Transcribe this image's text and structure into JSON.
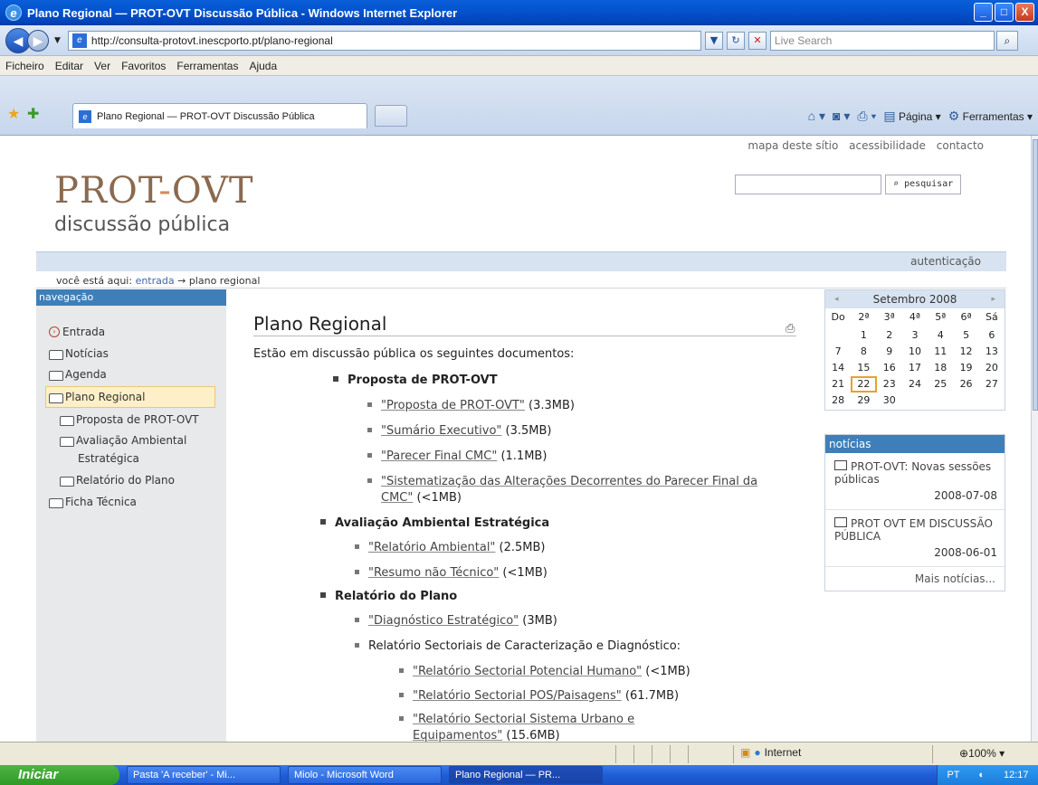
{
  "window": {
    "title": "Plano Regional — PROT-OVT Discussão Pública - Windows Internet Explorer",
    "buttons": {
      "min": "_",
      "max": "□",
      "close": "X"
    }
  },
  "browser": {
    "url": "http://consulta-protovt.inescporto.pt/plano-regional",
    "search_placeholder": "Live Search",
    "menu": [
      "Ficheiro",
      "Editar",
      "Ver",
      "Favoritos",
      "Ferramentas",
      "Ajuda"
    ],
    "tab_title": "Plano Regional — PROT-OVT Discussão Pública",
    "cmd": {
      "page": "Página",
      "tools": "Ferramentas"
    },
    "status": {
      "zone": "Internet",
      "zoom": "100%"
    }
  },
  "site": {
    "top_links": [
      "mapa deste sítio",
      "acessibilidade",
      "contacto"
    ],
    "logo_a": "PROT",
    "logo_dash": "-",
    "logo_b": "OVT",
    "logo_sub": "discussão pública",
    "search_button": "pesquisar",
    "auth": "autenticação",
    "crumb_prefix": "você está aqui:",
    "crumb_home": "entrada",
    "crumb_arrow": "→",
    "crumb_current": "plano regional"
  },
  "nav": {
    "head": "navegação",
    "items": [
      "Entrada",
      "Notícias",
      "Agenda",
      "Plano Regional",
      "Proposta de PROT-OVT",
      "Avaliação Ambiental",
      "Estratégica",
      "Relatório do Plano",
      "Ficha Técnica"
    ]
  },
  "content": {
    "title": "Plano Regional",
    "intro": "Estão em discussão pública os seguintes documentos:",
    "s1": "Proposta de PROT-OVT",
    "d1": "\"Proposta de PROT-OVT\"",
    "d1s": " (3.3MB)",
    "d2": "\"Sumário Executivo\"",
    "d2s": " (3.5MB)",
    "d3": "\"Parecer Final CMC\"",
    "d3s": " (1.1MB)",
    "d4a": "\"Sistematização das Alterações Decorrentes do Parecer Final da",
    "d4b": "CMC\"",
    "d4s": " (<1MB)",
    "s2": "Avaliação Ambiental Estratégica",
    "d5": "\"Relatório Ambiental\"",
    "d5s": " (2.5MB)",
    "d6": "\"Resumo não Técnico\"",
    "d6s": " (<1MB)",
    "s3": "Relatório do Plano",
    "d7": "\"Diagnóstico Estratégico\"",
    "d7s": " (3MB)",
    "d8": "Relatório Sectoriais de Caracterização e Diagnóstico:",
    "d9": "\"Relatório Sectorial Potencial Humano\"",
    "d9s": " (<1MB)",
    "d10": "\"Relatório Sectorial POS/Paisagens\"",
    "d10s": " (61.7MB)",
    "d11a": "\"Relatório Sectorial Sistema Urbano e",
    "d11b": "Equipamentos\"",
    "d11s": " (15.6MB)"
  },
  "calendar": {
    "month": "Setembro 2008",
    "prev": "◂",
    "next": "▸",
    "days": [
      "Do",
      "2ª",
      "3ª",
      "4ª",
      "5ª",
      "6ª",
      "Sá"
    ],
    "cells": [
      "",
      "1",
      "2",
      "3",
      "4",
      "5",
      "6",
      "7",
      "8",
      "9",
      "10",
      "11",
      "12",
      "13",
      "14",
      "15",
      "16",
      "17",
      "18",
      "19",
      "20",
      "21",
      "22",
      "23",
      "24",
      "25",
      "26",
      "27",
      "28",
      "29",
      "30",
      "",
      "",
      "",
      ""
    ],
    "today": "22"
  },
  "news": {
    "head": "notícias",
    "items": [
      {
        "title": "PROT-OVT: Novas sessões públicas",
        "date": "2008-07-08"
      },
      {
        "title": "PROT OVT EM DISCUSSÃO PÚBLICA",
        "date": "2008-06-01"
      }
    ],
    "more": "Mais notícias..."
  },
  "taskbar": {
    "start": "Iniciar",
    "tasks": [
      "Pasta 'A receber' - Mi...",
      "Miolo - Microsoft Word",
      "Plano Regional — PR..."
    ],
    "lang": "PT",
    "clock": "12:17"
  }
}
